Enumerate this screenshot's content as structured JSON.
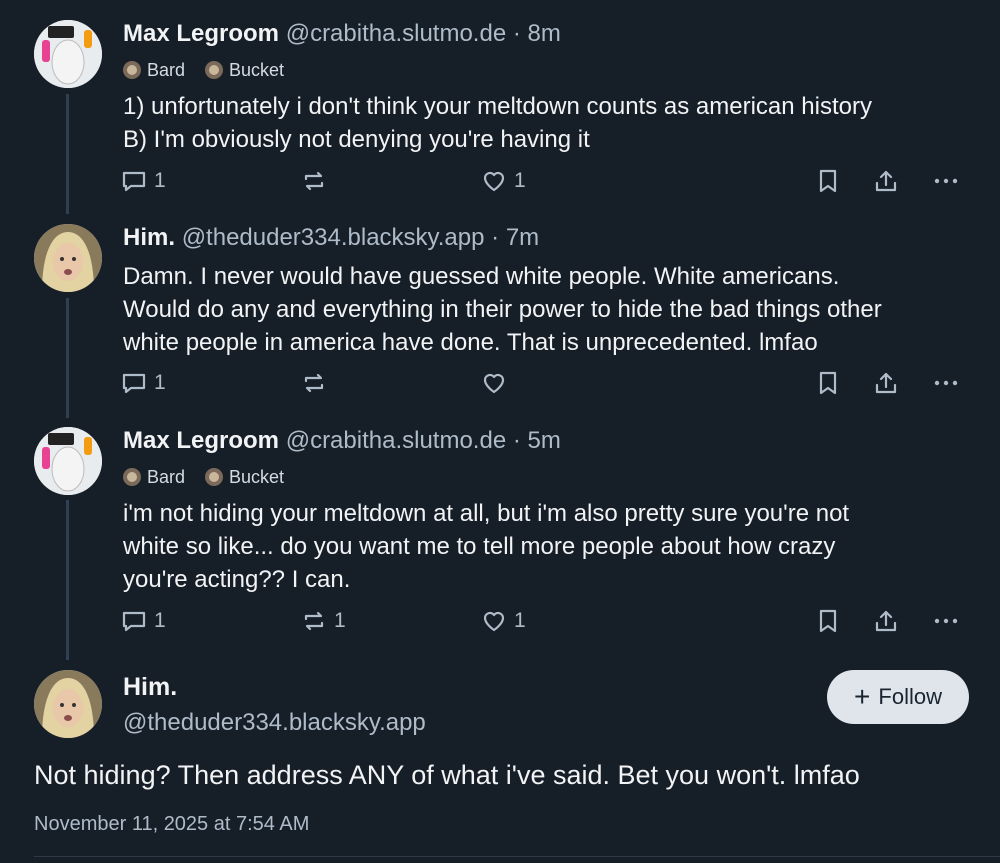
{
  "colors": {
    "background": "#161e27",
    "text": "#f1f3f5",
    "muted": "#aebbc9",
    "thread_line": "#2e4052",
    "follow_bg": "#dfe5eb"
  },
  "replies": [
    {
      "name": "Max Legroom",
      "handle": "@crabitha.slutmo.de",
      "separator": "·",
      "time": "8m",
      "badges": [
        "Bard",
        "Bucket"
      ],
      "lines": [
        "1) unfortunately i don't think your meltdown counts as american history",
        "B) I'm obviously not denying you're having it"
      ],
      "reply_count": "1",
      "repost_count": "",
      "like_count": "1"
    },
    {
      "name": "Him.",
      "handle": "@theduder334.blacksky.app",
      "separator": "·",
      "time": "7m",
      "badges": [],
      "lines": [
        "Damn. I never would have guessed white people. White americans.",
        "Would do any and everything in their power to hide the bad things other",
        "white people in america have done. That is unprecedented. lmfao"
      ],
      "reply_count": "1",
      "repost_count": "",
      "like_count": ""
    },
    {
      "name": "Max Legroom",
      "handle": "@crabitha.slutmo.de",
      "separator": "·",
      "time": "5m",
      "badges": [
        "Bard",
        "Bucket"
      ],
      "lines": [
        "i'm not hiding your meltdown at all, but i'm also pretty sure you're not",
        "white so like... do you want me to tell more people about how crazy",
        "you're acting?? I can."
      ],
      "reply_count": "1",
      "repost_count": "1",
      "like_count": "1"
    }
  ],
  "main_post": {
    "name": "Him.",
    "handle": "@theduder334.blacksky.app",
    "follow_label": "Follow",
    "follow_icon": "+",
    "text": "Not hiding? Then address ANY of what i've said. Bet you won't. lmfao",
    "date": "November 11, 2025 at 7:54 AM"
  },
  "icons": {
    "reply": "speech-bubble-icon",
    "repost": "repost-arrows-icon",
    "like": "heart-icon",
    "bookmark": "bookmark-icon",
    "share": "share-icon",
    "more": "ellipsis-icon"
  }
}
